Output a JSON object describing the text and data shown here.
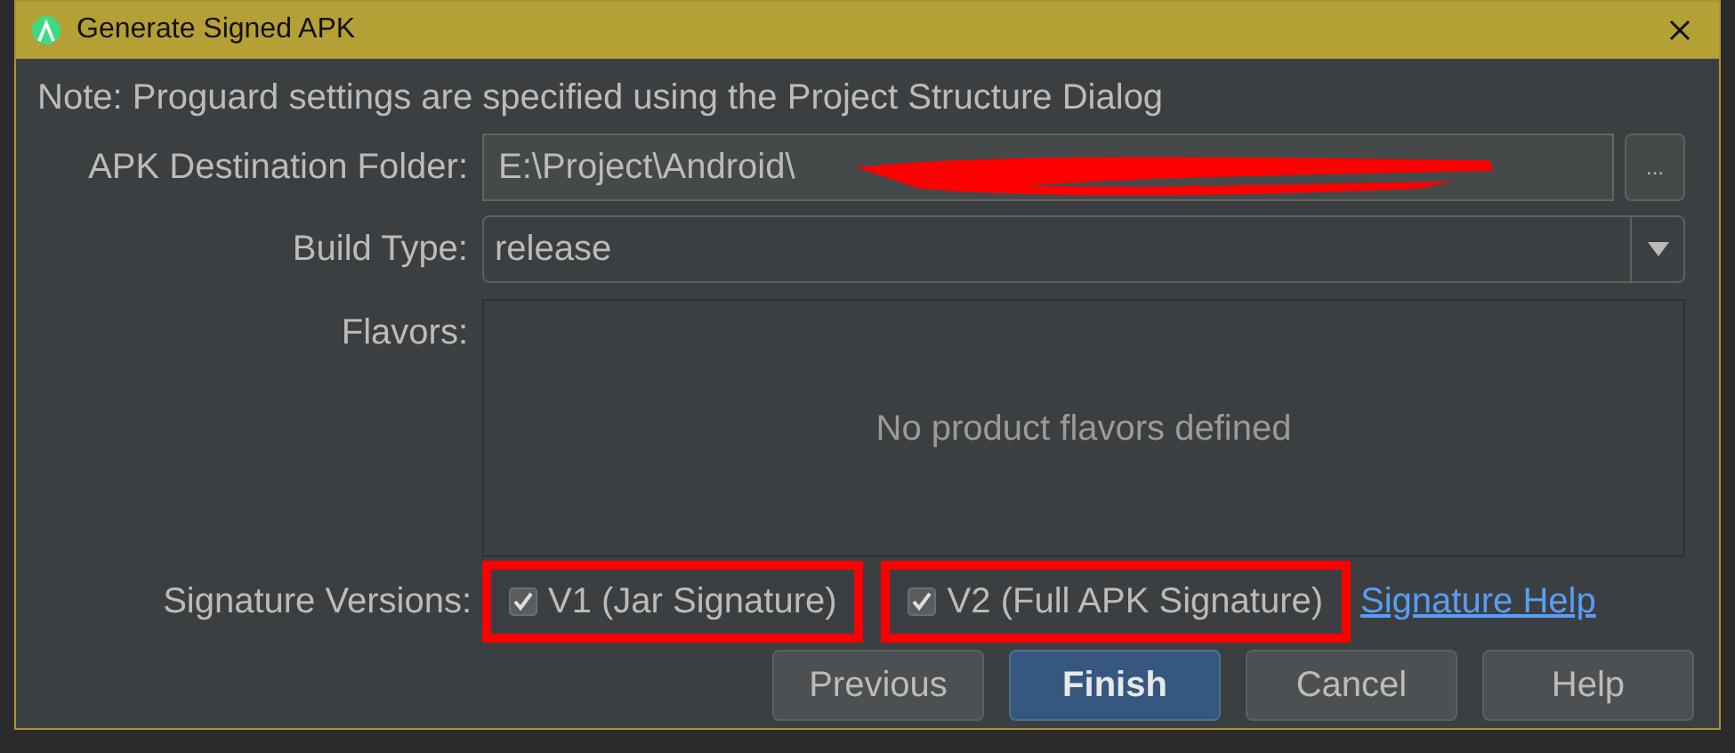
{
  "window": {
    "title": "Generate Signed APK"
  },
  "note": "Note: Proguard settings are specified using the Project Structure Dialog",
  "destination": {
    "label": "APK Destination Folder:",
    "value": "E:\\Project\\Android\\",
    "browse": "...",
    "redacted": true
  },
  "build_type": {
    "label": "Build Type:",
    "value": "release"
  },
  "flavors": {
    "label": "Flavors:",
    "empty_text": "No product flavors defined"
  },
  "signature": {
    "label": "Signature Versions:",
    "options": [
      {
        "label": "V1 (Jar Signature)",
        "checked": true,
        "highlighted": true
      },
      {
        "label": "V2 (Full APK Signature)",
        "checked": true,
        "highlighted": true
      }
    ],
    "help_link": "Signature Help"
  },
  "buttons": [
    {
      "label": "Previous",
      "default": false
    },
    {
      "label": "Finish",
      "default": true
    },
    {
      "label": "Cancel",
      "default": false
    },
    {
      "label": "Help",
      "default": false
    }
  ]
}
